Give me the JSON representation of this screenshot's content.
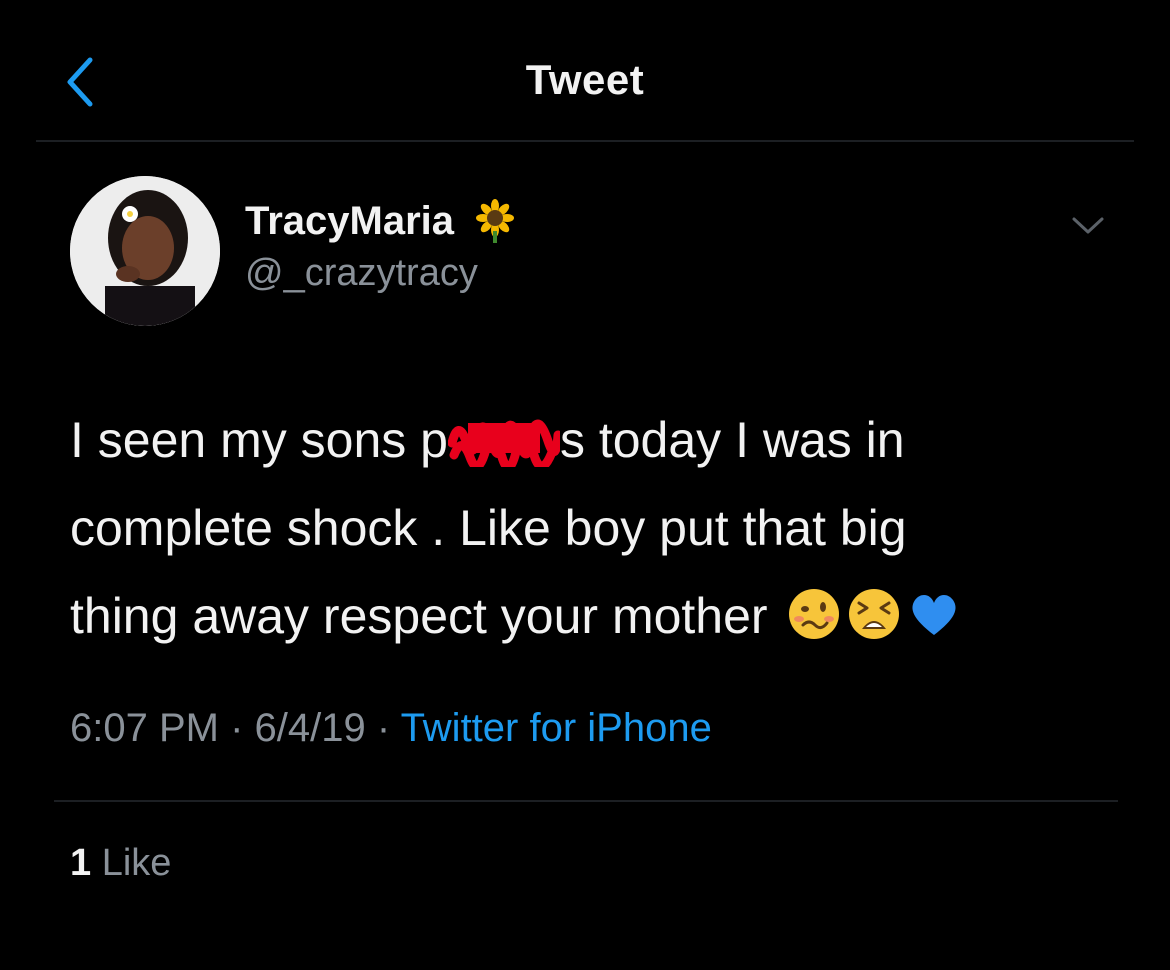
{
  "header": {
    "title": "Tweet",
    "back_icon": "chevron-left-icon",
    "accent_color": "#1d9bf0"
  },
  "tweet": {
    "display_name": "TracyMaria",
    "name_emoji": "sunflower-emoji",
    "handle": "@_crazytracy",
    "menu_icon": "chevron-down-icon",
    "text_lines": {
      "line1_before": "I seen my sons p",
      "line1_after": "s today I was in",
      "line2": "complete shock . Like boy put that big",
      "line3": "thing away respect your mother"
    },
    "redaction_color": "#e8001c",
    "trailing_emojis": [
      "woozy-face-emoji",
      "tired-face-emoji",
      "blue-heart-emoji"
    ],
    "time": "6:07 PM",
    "separator": " · ",
    "date": "6/4/19",
    "source": "Twitter for iPhone"
  },
  "stats": {
    "like_count": "1",
    "like_label": "Like"
  }
}
